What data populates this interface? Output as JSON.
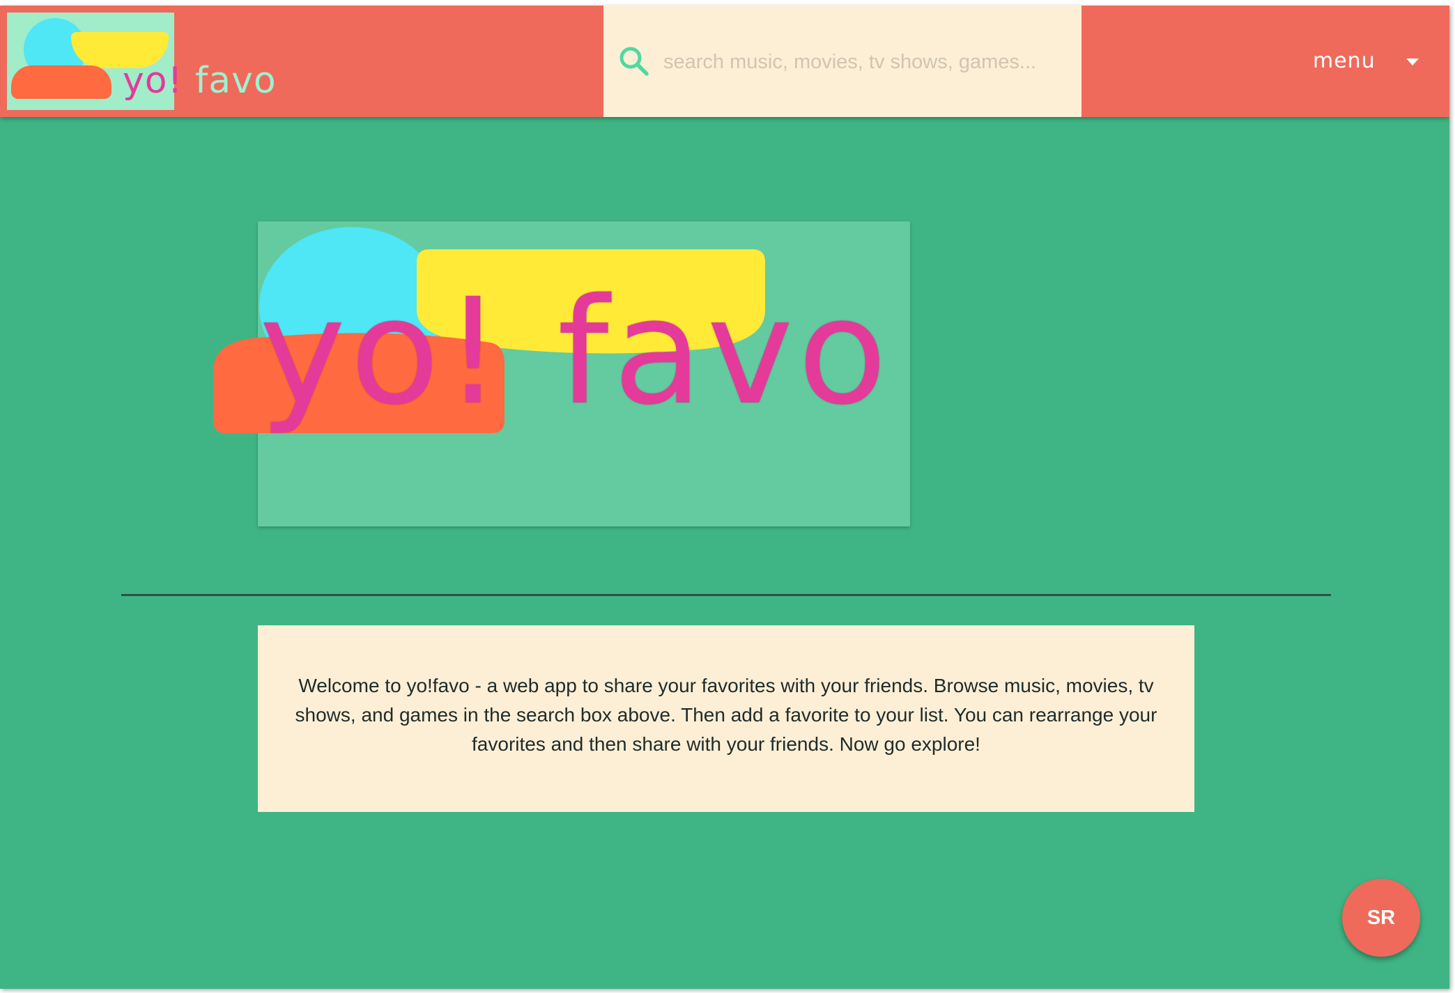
{
  "navbar": {
    "brand_part1": "yo!",
    "brand_part2": "favo",
    "logo_icon": "yofavo-logo-icon"
  },
  "search": {
    "placeholder": "search music, movies, tv shows, games...",
    "value": "",
    "icon": "search-icon"
  },
  "menu": {
    "label": "menu",
    "icon": "chevron-down-icon"
  },
  "hero": {
    "title": "yo! favo"
  },
  "welcome": {
    "text": "Welcome to yo!favo - a web app to share your favorites with your friends. Browse music, movies, tv shows, and games in the search box above. Then add a favorite to your list. You can rearrange your favorites and then share with your friends. Now go explore!"
  },
  "avatar": {
    "initials": "SR"
  },
  "colors": {
    "background": "#3fb585",
    "navbar": "#ef6a5a",
    "search_bg": "#fdefd6",
    "hero_bg": "#63cb9f",
    "brand_pink": "#e43a9a",
    "shape_cyan": "#4fe6f5",
    "shape_yellow": "#ffea38",
    "shape_orange": "#ff6a40"
  }
}
